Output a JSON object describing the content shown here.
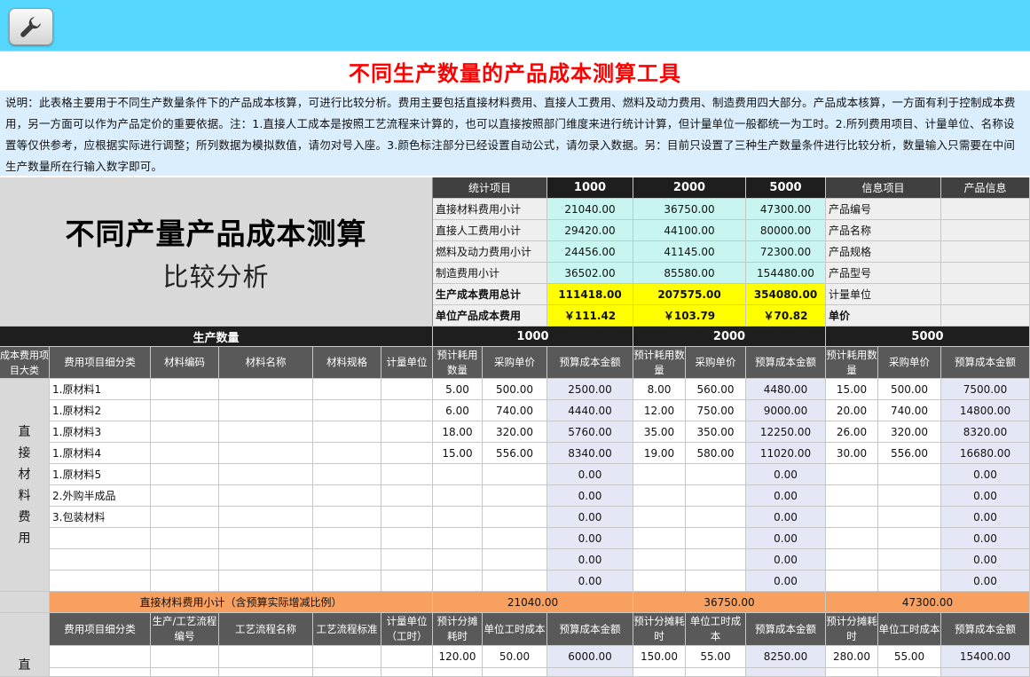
{
  "toolbar": {
    "tool_icon": "wrench-icon"
  },
  "page_title": "不同生产数量的产品成本测算工具",
  "description": "说明：此表格主要用于不同生产数量条件下的产品成本核算，可进行比较分析。费用主要包括直接材料费用、直接人工费用、燃料及动力费用、制造费用四大部分。产品成本核算，一方面有利于控制成本费用，另一方面可以作为产品定价的重要依据。注：1.直接人工成本是按照工艺流程来计算的，也可以直接按照部门维度来进行统计计算，但计量单位一般都统一为工时。2.所列费用项目、计量单位、名称设置等仅供参考，应根据实际进行调整；所列数据为模拟数值，请勿对号入座。3.颜色标注部分已经设置自动公式，请勿录入数据。另：目前只设置了三种生产数量条件进行比较分析，数量输入只需要在中间生产数量所在行输入数字即可。",
  "summary": {
    "title_main": "不同产量产品成本测算",
    "title_sub": "比较分析",
    "headers": [
      "统计项目",
      "1000",
      "2000",
      "5000",
      "信息项目",
      "产品信息"
    ],
    "rows": [
      {
        "label": "直接材料费用小计",
        "v": [
          "21040.00",
          "36750.00",
          "47300.00"
        ],
        "info": "产品编号"
      },
      {
        "label": "直接人工费用小计",
        "v": [
          "29420.00",
          "44100.00",
          "80000.00"
        ],
        "info": "产品名称"
      },
      {
        "label": "燃料及动力费用小计",
        "v": [
          "24456.00",
          "41145.00",
          "72300.00"
        ],
        "info": "产品规格"
      },
      {
        "label": "制造费用小计",
        "v": [
          "36502.00",
          "85580.00",
          "154480.00"
        ],
        "info": "产品型号"
      },
      {
        "label": "生产成本费用总计",
        "v": [
          "111418.00",
          "207575.00",
          "354080.00"
        ],
        "info": "计量单位"
      },
      {
        "label": "单位产品成本费用",
        "v": [
          "￥111.42",
          "￥103.79",
          "￥70.82"
        ],
        "info": "单价"
      }
    ]
  },
  "quantity_header": {
    "label": "生产数量",
    "q": [
      "1000",
      "2000",
      "5000"
    ]
  },
  "material_section": {
    "category": "成本费用项目大类",
    "side_label": [
      "直",
      "接",
      "材",
      "料",
      "费",
      "用"
    ],
    "columns": [
      "费用项目细分类",
      "材料编码",
      "材料名称",
      "材料规格",
      "计量单位"
    ],
    "group_columns": [
      "预计耗用数量",
      "采购单价",
      "预算成本金额"
    ],
    "group_columns_2": [
      "预计耗用数量",
      "采购单价",
      "预算成本金额"
    ],
    "group_columns_3": [
      "预计耗用数量",
      "采购单价",
      "预算成本金额"
    ],
    "rows": [
      {
        "item": "1.原材料1",
        "g": [
          [
            "5.00",
            "500.00",
            "2500.00"
          ],
          [
            "8.00",
            "560.00",
            "4480.00"
          ],
          [
            "15.00",
            "500.00",
            "7500.00"
          ]
        ]
      },
      {
        "item": "1.原材料2",
        "g": [
          [
            "6.00",
            "740.00",
            "4440.00"
          ],
          [
            "12.00",
            "750.00",
            "9000.00"
          ],
          [
            "20.00",
            "740.00",
            "14800.00"
          ]
        ]
      },
      {
        "item": "1.原材料3",
        "g": [
          [
            "18.00",
            "320.00",
            "5760.00"
          ],
          [
            "35.00",
            "350.00",
            "12250.00"
          ],
          [
            "26.00",
            "320.00",
            "8320.00"
          ]
        ]
      },
      {
        "item": "1.原材料4",
        "g": [
          [
            "15.00",
            "556.00",
            "8340.00"
          ],
          [
            "19.00",
            "580.00",
            "11020.00"
          ],
          [
            "30.00",
            "556.00",
            "16680.00"
          ]
        ]
      },
      {
        "item": "1.原材料5",
        "g": [
          [
            "",
            "",
            "0.00"
          ],
          [
            "",
            "",
            "0.00"
          ],
          [
            "",
            "",
            "0.00"
          ]
        ]
      },
      {
        "item": "2.外购半成品",
        "g": [
          [
            "",
            "",
            "0.00"
          ],
          [
            "",
            "",
            "0.00"
          ],
          [
            "",
            "",
            "0.00"
          ]
        ]
      },
      {
        "item": "3.包装材料",
        "g": [
          [
            "",
            "",
            "0.00"
          ],
          [
            "",
            "",
            "0.00"
          ],
          [
            "",
            "",
            "0.00"
          ]
        ]
      },
      {
        "item": "",
        "g": [
          [
            "",
            "",
            "0.00"
          ],
          [
            "",
            "",
            "0.00"
          ],
          [
            "",
            "",
            "0.00"
          ]
        ]
      },
      {
        "item": "",
        "g": [
          [
            "",
            "",
            "0.00"
          ],
          [
            "",
            "",
            "0.00"
          ],
          [
            "",
            "",
            "0.00"
          ]
        ]
      },
      {
        "item": "",
        "g": [
          [
            "",
            "",
            "0.00"
          ],
          [
            "",
            "",
            "0.00"
          ],
          [
            "",
            "",
            "0.00"
          ]
        ]
      }
    ],
    "subtotal_label": "直接材料费用小计（含预算实际增减比例）",
    "subtotal": [
      "21040.00",
      "36750.00",
      "47300.00"
    ]
  },
  "labor_section": {
    "side_label": [
      "直"
    ],
    "columns": [
      "费用项目细分类",
      "生产/工艺流程编号",
      "工艺流程名称",
      "工艺流程标准",
      "计量单位（工时）"
    ],
    "group_columns": [
      "预计分摊耗时",
      "单位工时成本",
      "预算成本金额"
    ],
    "group_columns_2": [
      "预计分摊耗时",
      "单位工时成本",
      "预算成本金额"
    ],
    "group_columns_3": [
      "预计分摊耗时",
      "单位工时成本",
      "预算成本金额"
    ],
    "rows": [
      {
        "g": [
          [
            "120.00",
            "50.00",
            "6000.00"
          ],
          [
            "150.00",
            "55.00",
            "8250.00"
          ],
          [
            "280.00",
            "55.00",
            "15400.00"
          ]
        ]
      }
    ]
  },
  "colors": {
    "topbar": "#55d7fe",
    "title": "#ff0000",
    "note_bg": "#dbeefd",
    "cyan": "#c8f5ef",
    "yellow": "#ffff00",
    "orange": "#f8a060",
    "blue_cell": "#e4e8f6"
  }
}
